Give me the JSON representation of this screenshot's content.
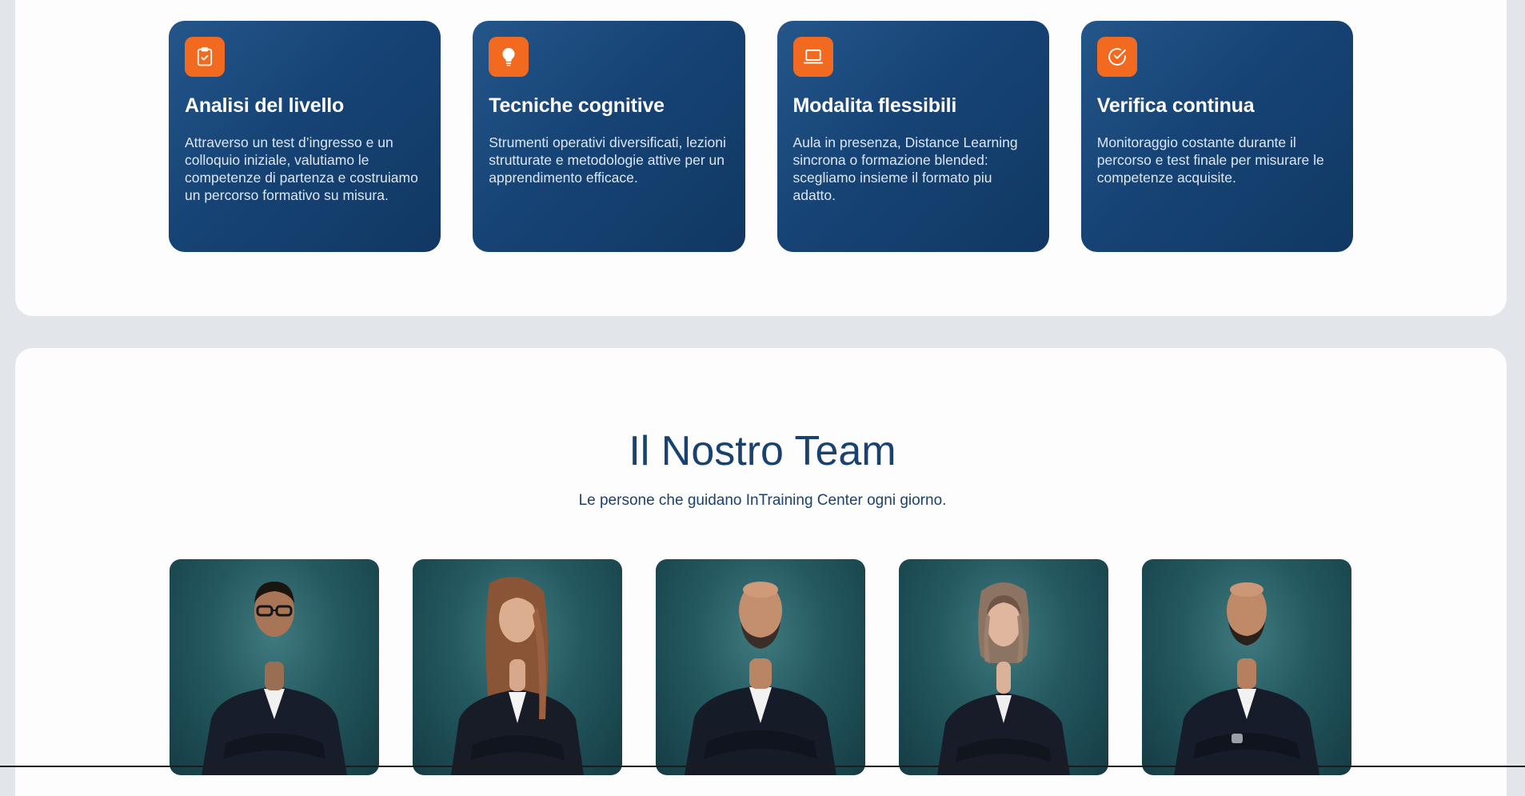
{
  "features": [
    {
      "icon": "clipboard-check-icon",
      "title": "Analisi del livello",
      "text": "Attraverso un test d’ingresso e un colloquio iniziale, valutiamo le competenze di partenza e costruiamo un percorso formativo su misura."
    },
    {
      "icon": "lightbulb-icon",
      "title": "Tecniche cognitive",
      "text": "Strumenti operativi diversificati, lezioni strutturate e metodologie attive per un apprendimento efficace."
    },
    {
      "icon": "laptop-icon",
      "title": "Modalita flessibili",
      "text": "Aula in presenza, Distance Learning sincrona o formazione blended: scegliamo insieme il formato piu adatto."
    },
    {
      "icon": "check-circle-icon",
      "title": "Verifica continua",
      "text": "Monitoraggio costante durante il percorso e test finale per misurare le competenze acquisite."
    }
  ],
  "team": {
    "title": "Il Nostro Team",
    "subtitle": "Le persone che guidano InTraining Center ogni giorno.",
    "members": [
      {
        "photo": "team-member-photo-1"
      },
      {
        "photo": "team-member-photo-2"
      },
      {
        "photo": "team-member-photo-3"
      },
      {
        "photo": "team-member-photo-4"
      },
      {
        "photo": "team-member-photo-5"
      }
    ]
  },
  "colors": {
    "page_bg": "#e2e5ea",
    "card_gradient_start": "#24568a",
    "card_gradient_end": "#113863",
    "accent_orange": "#f26a1f",
    "heading_navy": "#1a426f"
  }
}
